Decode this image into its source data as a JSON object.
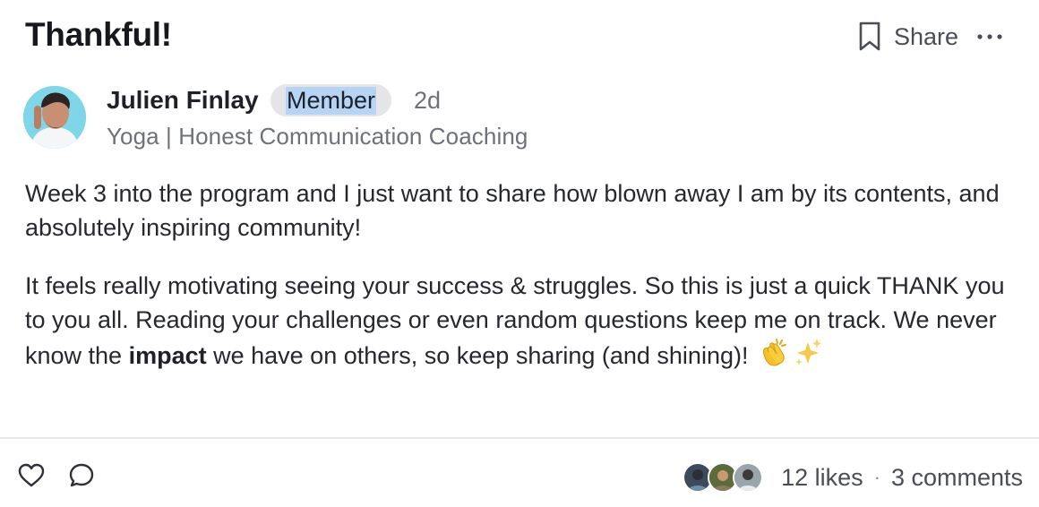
{
  "post": {
    "title": "Thankful!",
    "share_label": "Share",
    "author": {
      "name": "Julien Finlay",
      "badge": "Member",
      "time": "2d",
      "subtitle": "Yoga | Honest Communication Coaching"
    },
    "body": {
      "paragraph1": "Week 3 into the program and I just want to share how blown away I am by its contents, and absolutely inspiring community!",
      "paragraph2_before": "It feels really motivating seeing your success & struggles. So this is just a quick THANK you to you all. Reading your challenges or even random questions keep me on track. We  never know the ",
      "paragraph2_bold": "impact",
      "paragraph2_after": " we have on others, so keep sharing (and shining)!"
    },
    "emojis": [
      "clapping-hands",
      "sparkles"
    ],
    "footer": {
      "likes": "12 likes",
      "separator": "·",
      "comments": "3 comments"
    }
  },
  "icons": [
    "bookmark-icon",
    "more-icon",
    "heart-icon",
    "comment-icon"
  ],
  "colors": {
    "badge_bg": "#e4e5e8",
    "badge_highlight": "#b6d4f6",
    "avatar_bg": "#7fd6e8",
    "muted_text": "#6e717a"
  }
}
